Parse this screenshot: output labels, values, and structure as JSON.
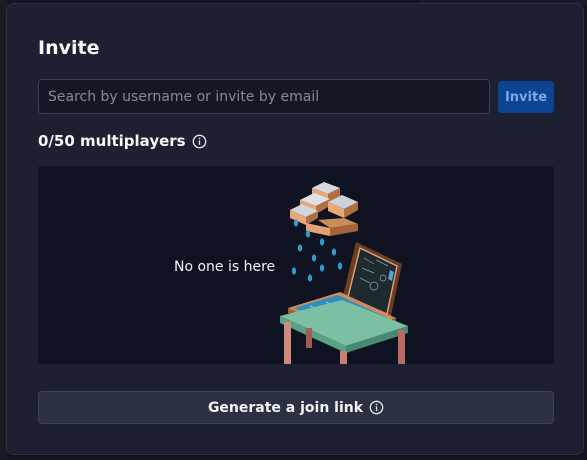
{
  "dialog": {
    "title": "Invite",
    "search": {
      "placeholder": "Search by username or invite by email",
      "value": ""
    },
    "invite_label": "Invite",
    "count_label": "0/50 multiplayers",
    "empty_state_text": "No one is here",
    "join_link_label": "Generate a join link"
  },
  "icons": {
    "info": "info-circle-icon",
    "illustration": "rainy-laptop-illustration"
  },
  "colors": {
    "modal_background": "#1c2030",
    "panel_background": "#0e1221",
    "invite_button": "#0b4493",
    "join_button": "#2b3042"
  }
}
